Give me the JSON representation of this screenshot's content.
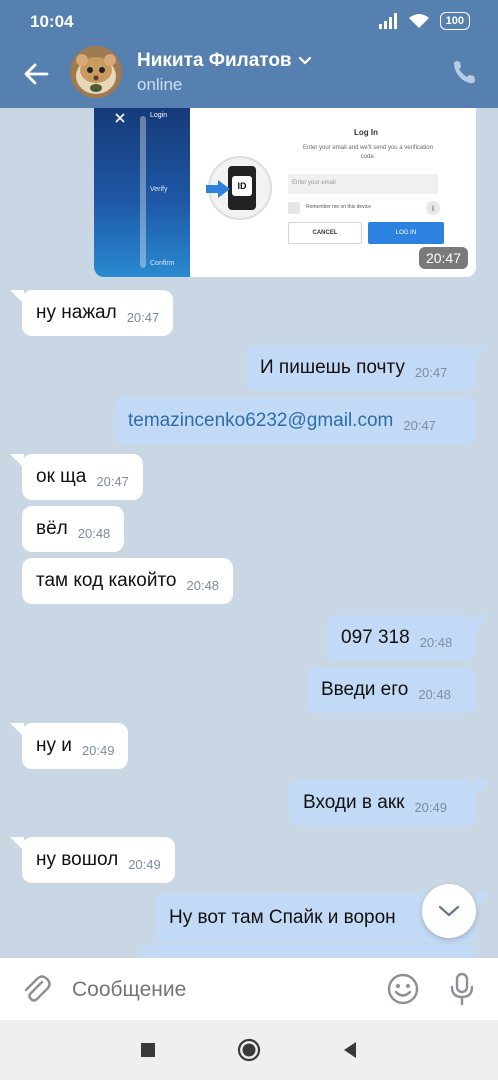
{
  "status_bar": {
    "time": "10:04",
    "battery": "100"
  },
  "header": {
    "contact_name": "Никита Филатов",
    "status": "online"
  },
  "photo": {
    "time": "20:47",
    "login_title": "Log In",
    "description": "Enter your email and we'll send you a verification code.",
    "email_placeholder": "Enter your email",
    "remember": "Remember me on this device",
    "cancel": "CANCEL",
    "login": "LOG IN",
    "side_login": "Login",
    "side_verify": "Verify",
    "side_confirm": "Confirm",
    "badge": "ID"
  },
  "messages": [
    {
      "dir": "in",
      "text": "ну нажал",
      "time": "20:47"
    },
    {
      "dir": "out",
      "text": "И пишешь почту",
      "time": "20:47"
    },
    {
      "dir": "out",
      "text": "temazincenko6232@gmail.com",
      "time": "20:47"
    },
    {
      "dir": "in",
      "text": "ок ща",
      "time": "20:47"
    },
    {
      "dir": "in",
      "text": "вёл",
      "time": "20:48"
    },
    {
      "dir": "in",
      "text": "там код какойто",
      "time": "20:48"
    },
    {
      "dir": "out",
      "text": "097 318",
      "time": "20:48"
    },
    {
      "dir": "out",
      "text": "Введи его",
      "time": "20:48"
    },
    {
      "dir": "in",
      "text": "ну и",
      "time": "20:49"
    },
    {
      "dir": "out",
      "text": "Входи в акк",
      "time": "20:49"
    },
    {
      "dir": "in",
      "text": "ну вошол",
      "time": "20:49"
    },
    {
      "dir": "out",
      "text": "Ну вот там Спайк и ворон",
      "time": ""
    }
  ],
  "composer": {
    "placeholder": "Сообщение"
  },
  "icons": [
    "back-arrow-icon",
    "chevron-down-icon",
    "phone-icon",
    "paperclip-icon",
    "emoji-icon",
    "microphone-icon",
    "scroll-down-icon",
    "recents-icon",
    "home-icon",
    "back-icon"
  ],
  "colors": {
    "header": "#5580b0",
    "chat_bg": "#c9d6e3",
    "outgoing": "#c3daf6",
    "incoming": "#ffffff",
    "link": "#2d6ea8"
  }
}
